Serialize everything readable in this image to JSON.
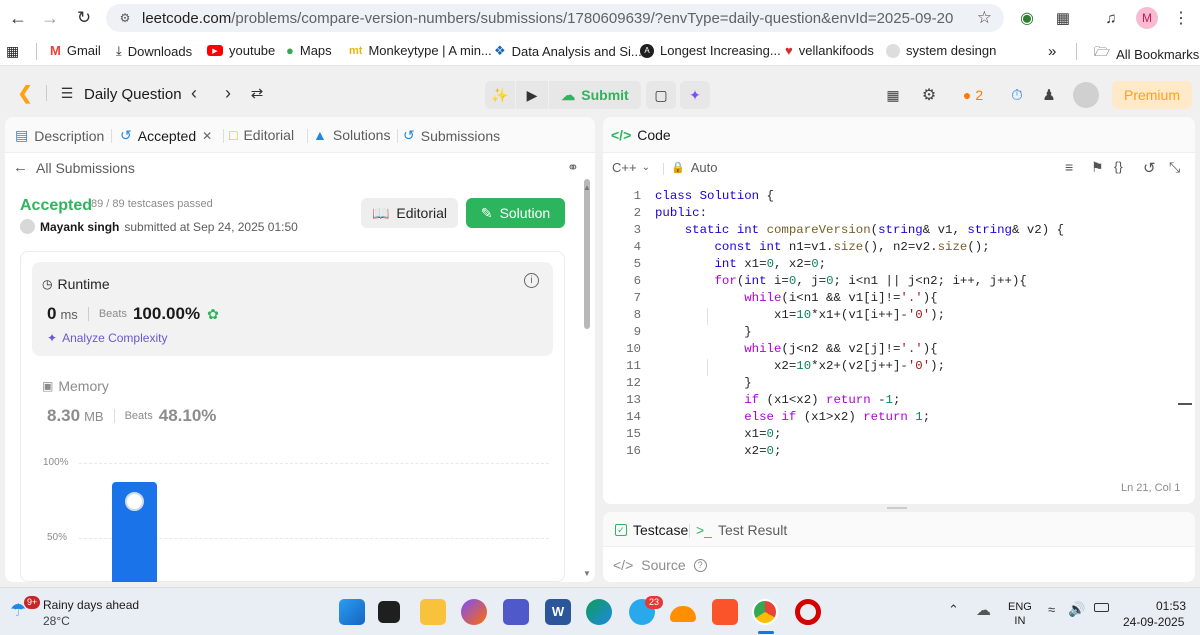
{
  "browser": {
    "url_host": "leetcode.com",
    "url_path": "/problems/compare-version-numbers/submissions/1780609639/?envType=daily-question&envId=2025-09-20",
    "profile_initial": "M",
    "bookmarks": [
      {
        "label": "Gmail",
        "icon": "gmail-icon",
        "color": "#ea4335"
      },
      {
        "label": "Downloads",
        "icon": "download-icon",
        "color": "#1f1f1f"
      },
      {
        "label": "youtube",
        "icon": "youtube-icon",
        "color": "#ff0000"
      },
      {
        "label": "Maps",
        "icon": "maps-icon",
        "color": "#34a853"
      },
      {
        "label": "Monkeytype | A min...",
        "icon": "monkeytype-icon",
        "color": "#e2b714"
      },
      {
        "label": "Data Analysis and Si...",
        "icon": "data-icon",
        "color": "#1565c0"
      },
      {
        "label": "Longest Increasing...",
        "icon": "longest-icon",
        "color": "#1f1f1f"
      },
      {
        "label": "vellankifoods",
        "icon": "heart-icon",
        "color": "#d32f2f"
      },
      {
        "label": "system desingn",
        "icon": "github-icon",
        "color": "#1f1f1f"
      }
    ],
    "all_bookmarks": "All Bookmarks",
    "overflow": "»"
  },
  "lc_nav": {
    "problem_list": "Daily Question",
    "submit": "Submit",
    "streak": "2",
    "premium": "Premium"
  },
  "left_panel": {
    "tabs": [
      "Description",
      "Accepted",
      "Editorial",
      "Solutions",
      "Submissions"
    ],
    "back_label": "All Submissions",
    "status": "Accepted",
    "testcases": "89 / 89 testcases passed",
    "user": "Mayank singh",
    "submitted_text": "submitted at Sep 24, 2025 01:50",
    "editorial_btn": "Editorial",
    "solution_btn": "Solution",
    "runtime": {
      "title": "Runtime",
      "value": "0",
      "unit": "ms",
      "beats_label": "Beats",
      "beats_value": "100.00%",
      "analyze": "Analyze Complexity"
    },
    "memory": {
      "title": "Memory",
      "value": "8.30",
      "unit": "MB",
      "beats_label": "Beats",
      "beats_value": "48.10%"
    },
    "chart": {
      "label_top": "100%",
      "label_mid": "50%"
    }
  },
  "editor": {
    "title": "Code",
    "language": "C++",
    "mode": "Auto",
    "cursor": "Ln 21, Col 1",
    "lines": [
      "class Solution {",
      "public:",
      "    static int compareVersion(string& v1, string& v2) {",
      "        const int n1=v1.size(), n2=v2.size();",
      "        int x1=0, x2=0;",
      "        for(int i=0, j=0; i<n1 || j<n2; i++, j++){",
      "            while(i<n1 && v1[i]!='.'){",
      "                x1=10*x1+(v1[i++]-'0');",
      "            }",
      "            while(j<n2 && v2[j]!='.'){",
      "                x2=10*x2+(v2[j++]-'0');",
      "            }",
      "            if (x1<x2) return -1;",
      "            else if (x1>x2) return 1;",
      "            x1=0;",
      "            x2=0;"
    ]
  },
  "bottom_panel": {
    "testcase": "Testcase",
    "test_result": "Test Result",
    "source": "Source"
  },
  "taskbar": {
    "weather_title": "Rainy days ahead",
    "weather_temp": "28°C",
    "weather_badge": "9+",
    "lang_1": "ENG",
    "lang_2": "IN",
    "time": "01:53",
    "date": "24-09-2025",
    "telegram_badge": "23"
  }
}
